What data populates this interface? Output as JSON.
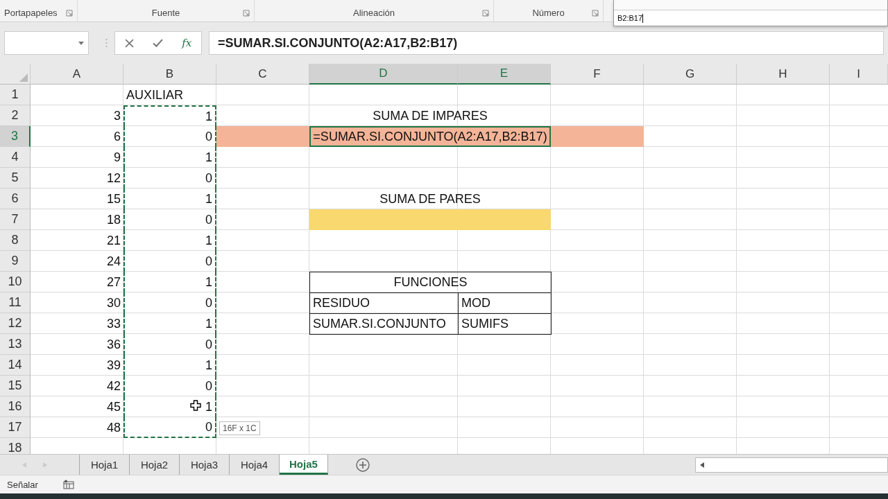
{
  "ribbon": {
    "groups": [
      {
        "label": "Portapapeles"
      },
      {
        "label": "Fuente"
      },
      {
        "label": "Alineación"
      },
      {
        "label": "Número"
      }
    ]
  },
  "function_arguments": {
    "value": "B2:B17"
  },
  "formula_bar": {
    "function_icon": "fx",
    "value": "=SUMAR.SI.CONJUNTO(A2:A17,B2:B17)"
  },
  "columns": [
    {
      "letter": "A",
      "selected": false
    },
    {
      "letter": "B",
      "selected": false
    },
    {
      "letter": "C",
      "selected": false
    },
    {
      "letter": "D",
      "selected": true
    },
    {
      "letter": "E",
      "selected": true
    },
    {
      "letter": "F",
      "selected": false
    },
    {
      "letter": "G",
      "selected": false
    },
    {
      "letter": "H",
      "selected": false
    },
    {
      "letter": "I",
      "selected": false
    }
  ],
  "rows": [
    {
      "number": "1",
      "selected": false,
      "B": {
        "text": "AUXILIAR",
        "marquee": false
      }
    },
    {
      "number": "2",
      "selected": false,
      "A": "3",
      "B": {
        "text": "1",
        "marquee": true
      },
      "feature": {
        "kind": "heading",
        "text": "SUMA DE IMPARES"
      }
    },
    {
      "number": "3",
      "selected": true,
      "A": "6",
      "B": {
        "text": "0",
        "marquee": true
      },
      "feature": {
        "kind": "formula",
        "text": "=SUMAR.SI.CONJUNTO(A2:A17,B2:B17)",
        "active": true
      }
    },
    {
      "number": "4",
      "selected": false,
      "A": "9",
      "B": {
        "text": "1",
        "marquee": true
      }
    },
    {
      "number": "5",
      "selected": false,
      "A": "12",
      "B": {
        "text": "0",
        "marquee": true
      }
    },
    {
      "number": "6",
      "selected": false,
      "A": "15",
      "B": {
        "text": "1",
        "marquee": true
      },
      "feature": {
        "kind": "heading",
        "text": "SUMA DE PARES"
      }
    },
    {
      "number": "7",
      "selected": false,
      "A": "18",
      "B": {
        "text": "0",
        "marquee": true
      },
      "feature": {
        "kind": "fill"
      }
    },
    {
      "number": "8",
      "selected": false,
      "A": "21",
      "B": {
        "text": "1",
        "marquee": true
      }
    },
    {
      "number": "9",
      "selected": false,
      "A": "24",
      "B": {
        "text": "0",
        "marquee": true
      }
    },
    {
      "number": "10",
      "selected": false,
      "A": "27",
      "B": {
        "text": "1",
        "marquee": true
      },
      "feature": {
        "kind": "table-heading",
        "text": "FUNCIONES"
      }
    },
    {
      "number": "11",
      "selected": false,
      "A": "30",
      "B": {
        "text": "0",
        "marquee": true
      },
      "feature": {
        "kind": "table-row",
        "cells": [
          "RESIDUO",
          "MOD"
        ]
      }
    },
    {
      "number": "12",
      "selected": false,
      "A": "33",
      "B": {
        "text": "1",
        "marquee": true
      },
      "feature": {
        "kind": "table-row",
        "cells": [
          "SUMAR.SI.CONJUNTO",
          "SUMIFS"
        ]
      }
    },
    {
      "number": "13",
      "selected": false,
      "A": "36",
      "B": {
        "text": "0",
        "marquee": true
      }
    },
    {
      "number": "14",
      "selected": false,
      "A": "39",
      "B": {
        "text": "1",
        "marquee": true
      }
    },
    {
      "number": "15",
      "selected": false,
      "A": "42",
      "B": {
        "text": "0",
        "marquee": true
      }
    },
    {
      "number": "16",
      "selected": false,
      "A": "45",
      "B": {
        "text": "1",
        "marquee": true
      }
    },
    {
      "number": "17",
      "selected": false,
      "A": "48",
      "B": {
        "text": "0",
        "marquee": true
      }
    },
    {
      "number": "18",
      "selected": false
    }
  ],
  "tooltip": "16F x 1C",
  "sheet_tabs": [
    {
      "label": "Hoja1",
      "selected": false
    },
    {
      "label": "Hoja2",
      "selected": false
    },
    {
      "label": "Hoja3",
      "selected": false
    },
    {
      "label": "Hoja4",
      "selected": false
    },
    {
      "label": "Hoja5",
      "selected": true
    }
  ],
  "status_bar": {
    "mode": "Señalar"
  }
}
